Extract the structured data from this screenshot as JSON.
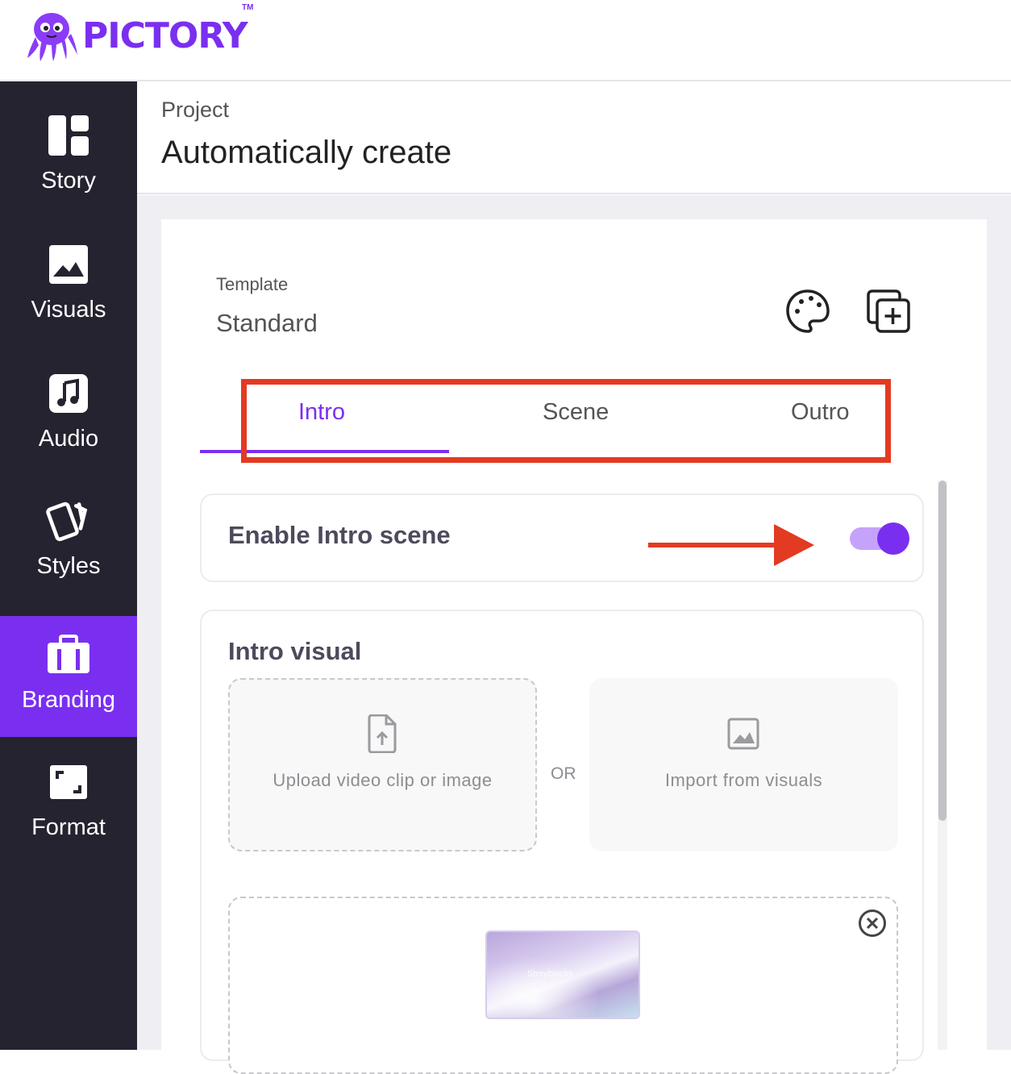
{
  "app": {
    "logo_text": "PICTORY",
    "trademark": "TM",
    "brand_color": "#7a2ff0"
  },
  "sidebar": {
    "items": [
      {
        "label": "Story",
        "icon": "layout-icon",
        "active": false
      },
      {
        "label": "Visuals",
        "icon": "image-icon",
        "active": false
      },
      {
        "label": "Audio",
        "icon": "music-note-icon",
        "active": false
      },
      {
        "label": "Styles",
        "icon": "cards-icon",
        "active": false
      },
      {
        "label": "Branding",
        "icon": "briefcase-icon",
        "active": true
      },
      {
        "label": "Format",
        "icon": "format-frame-icon",
        "active": false
      }
    ]
  },
  "header": {
    "breadcrumb": "Project",
    "title": "Automatically create"
  },
  "template": {
    "label": "Template",
    "value": "Standard",
    "palette_icon": "palette-icon",
    "duplicate_icon": "duplicate-add-icon"
  },
  "tabs": [
    {
      "label": "Intro",
      "active": true
    },
    {
      "label": "Scene",
      "active": false
    },
    {
      "label": "Outro",
      "active": false
    }
  ],
  "enable_intro": {
    "label": "Enable Intro scene",
    "enabled": true
  },
  "intro_visual": {
    "title": "Intro visual",
    "upload_label": "Upload video clip or image",
    "or_label": "OR",
    "import_label": "Import from visuals",
    "thumbnail_text": "Storyblocks"
  },
  "annotation_colors": {
    "highlight": "#e33a22"
  }
}
